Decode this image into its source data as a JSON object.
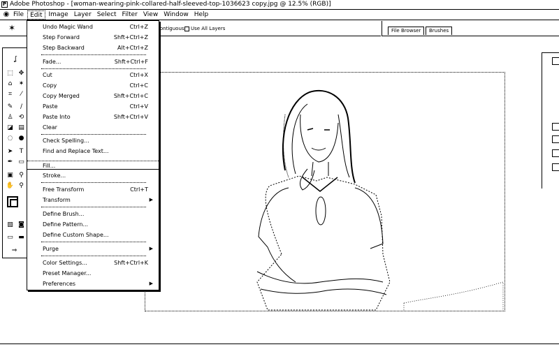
{
  "window": {
    "title": "Adobe Photoshop - [woman-wearing-pink-collared-half-sleeved-top-1036623 copy.jpg @ 12.5% (RGB)]"
  },
  "menubar": {
    "items": [
      "File",
      "Edit",
      "Image",
      "Layer",
      "Select",
      "Filter",
      "View",
      "Window",
      "Help"
    ],
    "active": "Edit"
  },
  "options": {
    "contiguous_label": "Contiguous",
    "use_all_layers_label": "Use All Layers"
  },
  "palette_well": {
    "tabs": [
      "File Browser",
      "Brushes"
    ]
  },
  "edit_menu": {
    "items": [
      {
        "label": "Undo Magic Wand",
        "shortcut": "Ctrl+Z"
      },
      {
        "label": "Step Forward",
        "shortcut": "Shft+Ctrl+Z"
      },
      {
        "label": "Step Backward",
        "shortcut": "Alt+Ctrl+Z"
      },
      {
        "label": "Fade...",
        "shortcut": "Shft+Ctrl+F"
      },
      {
        "label": "Cut",
        "shortcut": "Ctrl+X"
      },
      {
        "label": "Copy",
        "shortcut": "Ctrl+C"
      },
      {
        "label": "Copy Merged",
        "shortcut": "Shft+Ctrl+C"
      },
      {
        "label": "Paste",
        "shortcut": "Ctrl+V"
      },
      {
        "label": "Paste Into",
        "shortcut": "Shft+Ctrl+V"
      },
      {
        "label": "Clear",
        "shortcut": ""
      },
      {
        "label": "Check Spelling...",
        "shortcut": ""
      },
      {
        "label": "Find and Replace Text...",
        "shortcut": ""
      },
      {
        "label": "Fill...",
        "shortcut": ""
      },
      {
        "label": "Stroke...",
        "shortcut": ""
      },
      {
        "label": "Free Transform",
        "shortcut": "Ctrl+T"
      },
      {
        "label": "Transform",
        "shortcut": ""
      },
      {
        "label": "Define Brush...",
        "shortcut": ""
      },
      {
        "label": "Define Pattern...",
        "shortcut": ""
      },
      {
        "label": "Define Custom Shape...",
        "shortcut": ""
      },
      {
        "label": "Purge",
        "shortcut": ""
      },
      {
        "label": "Color Settings...",
        "shortcut": "Shft+Ctrl+K"
      },
      {
        "label": "Preset Manager...",
        "shortcut": ""
      },
      {
        "label": "Preferences",
        "shortcut": ""
      }
    ],
    "highlighted": "Fill..."
  },
  "icons": {
    "app": "photoshop-eye-icon",
    "options_tool": "magic-wand-icon",
    "submenu": "triangle-right-icon"
  }
}
